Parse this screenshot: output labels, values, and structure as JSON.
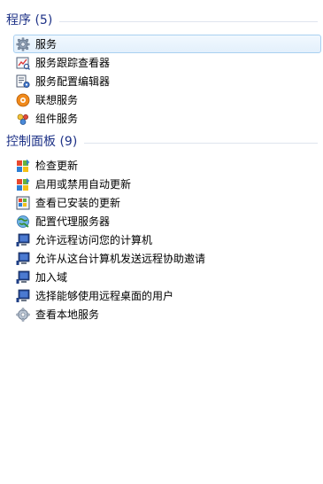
{
  "programs": {
    "title": "程序 (5)",
    "items": [
      {
        "label": "服务",
        "icon": "gear-icon"
      },
      {
        "label": "服务跟踪查看器",
        "icon": "trace-viewer-icon"
      },
      {
        "label": "服务配置编辑器",
        "icon": "config-editor-icon"
      },
      {
        "label": "联想服务",
        "icon": "lenovo-service-icon"
      },
      {
        "label": "组件服务",
        "icon": "component-services-icon"
      }
    ]
  },
  "control_panel": {
    "title": "控制面板 (9)",
    "items": [
      {
        "label": "检查更新",
        "icon": "windows-update-icon"
      },
      {
        "label": "启用或禁用自动更新",
        "icon": "windows-update-icon"
      },
      {
        "label": "查看已安装的更新",
        "icon": "installed-updates-icon"
      },
      {
        "label": "配置代理服务器",
        "icon": "proxy-icon"
      },
      {
        "label": "允许远程访问您的计算机",
        "icon": "remote-computer-icon"
      },
      {
        "label": "允许从这台计算机发送远程协助邀请",
        "icon": "remote-computer-icon"
      },
      {
        "label": "加入域",
        "icon": "remote-computer-icon"
      },
      {
        "label": "选择能够使用远程桌面的用户",
        "icon": "remote-computer-icon"
      },
      {
        "label": "查看本地服务",
        "icon": "local-services-icon"
      }
    ]
  }
}
